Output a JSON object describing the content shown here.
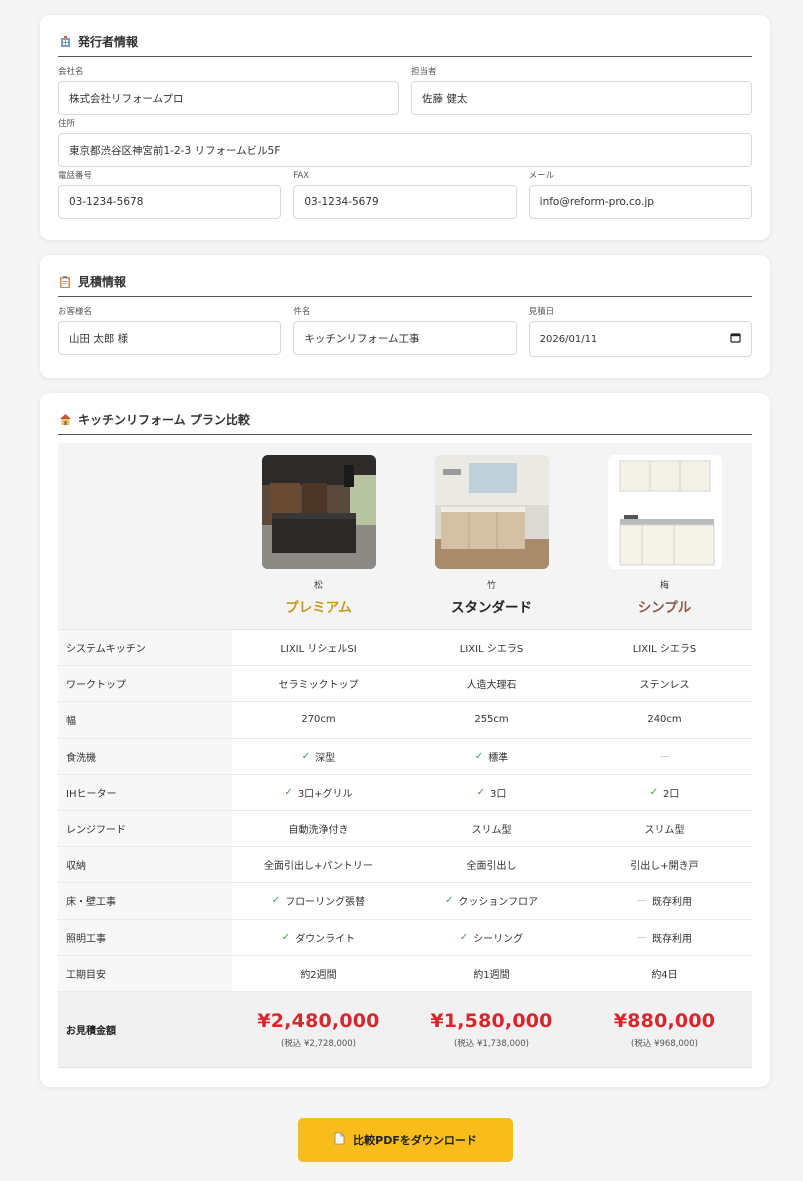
{
  "issuer": {
    "title": "発行者情報",
    "company_label": "会社名",
    "company_value": "株式会社リフォームプロ",
    "person_label": "担当者",
    "person_value": "佐藤 健太",
    "address_label": "住所",
    "address_value": "東京都渋谷区神宮前1-2-3 リフォームビル5F",
    "phone_label": "電話番号",
    "phone_value": "03-1234-5678",
    "fax_label": "FAX",
    "fax_value": "03-1234-5679",
    "email_label": "メール",
    "email_value": "info@reform-pro.co.jp"
  },
  "estimate": {
    "title": "見積情報",
    "customer_label": "お客様名",
    "customer_value": "山田 太郎 様",
    "subject_label": "件名",
    "subject_value": "キッチンリフォーム工事",
    "date_label": "見積日",
    "date_value": "2026/01/11"
  },
  "comparison": {
    "title": "キッチンリフォーム プラン比較",
    "plans": [
      {
        "tier": "松",
        "name": "プレミアム",
        "color": "#c9971c"
      },
      {
        "tier": "竹",
        "name": "スタンダード",
        "color": "#222222"
      },
      {
        "tier": "梅",
        "name": "シンプル",
        "color": "#8a5a4a"
      }
    ],
    "rows": [
      {
        "label": "システムキッチン",
        "cells": [
          {
            "text": "LIXIL リシェルSI",
            "mark": ""
          },
          {
            "text": "LIXIL シエラS",
            "mark": ""
          },
          {
            "text": "LIXIL シエラS",
            "mark": ""
          }
        ]
      },
      {
        "label": "ワークトップ",
        "cells": [
          {
            "text": "セラミックトップ",
            "mark": ""
          },
          {
            "text": "人造大理石",
            "mark": ""
          },
          {
            "text": "ステンレス",
            "mark": ""
          }
        ]
      },
      {
        "label": "幅",
        "cells": [
          {
            "text": "270cm",
            "mark": ""
          },
          {
            "text": "255cm",
            "mark": ""
          },
          {
            "text": "240cm",
            "mark": ""
          }
        ]
      },
      {
        "label": "食洗機",
        "cells": [
          {
            "text": "深型",
            "mark": "✓"
          },
          {
            "text": "標準",
            "mark": "✓"
          },
          {
            "text": "",
            "mark": "—"
          }
        ]
      },
      {
        "label": "IHヒーター",
        "cells": [
          {
            "text": "3口+グリル",
            "mark": "✓"
          },
          {
            "text": "3口",
            "mark": "✓"
          },
          {
            "text": "2口",
            "mark": "✓"
          }
        ]
      },
      {
        "label": "レンジフード",
        "cells": [
          {
            "text": "自動洗浄付き",
            "mark": ""
          },
          {
            "text": "スリム型",
            "mark": ""
          },
          {
            "text": "スリム型",
            "mark": ""
          }
        ]
      },
      {
        "label": "収納",
        "cells": [
          {
            "text": "全面引出し+パントリー",
            "mark": ""
          },
          {
            "text": "全面引出し",
            "mark": ""
          },
          {
            "text": "引出し+開き戸",
            "mark": ""
          }
        ]
      },
      {
        "label": "床・壁工事",
        "cells": [
          {
            "text": "フローリング張替",
            "mark": "✓"
          },
          {
            "text": "クッションフロア",
            "mark": "✓"
          },
          {
            "text": "既存利用",
            "mark": "—"
          }
        ]
      },
      {
        "label": "照明工事",
        "cells": [
          {
            "text": "ダウンライト",
            "mark": "✓"
          },
          {
            "text": "シーリング",
            "mark": "✓"
          },
          {
            "text": "既存利用",
            "mark": "—"
          }
        ]
      },
      {
        "label": "工期目安",
        "cells": [
          {
            "text": "約2週間",
            "mark": ""
          },
          {
            "text": "約1週間",
            "mark": ""
          },
          {
            "text": "約4日",
            "mark": ""
          }
        ]
      }
    ],
    "total_label": "お見積金額",
    "prices": [
      {
        "price": "¥2,480,000",
        "tax": "(税込 ¥2,728,000)"
      },
      {
        "price": "¥1,580,000",
        "tax": "(税込 ¥1,738,000)"
      },
      {
        "price": "¥880,000",
        "tax": "(税込 ¥968,000)"
      }
    ]
  },
  "download_button": "比較PDFをダウンロード",
  "colors": {
    "accent": "#f8bd1a",
    "price": "#d8262d",
    "check": "#3aa14b"
  }
}
